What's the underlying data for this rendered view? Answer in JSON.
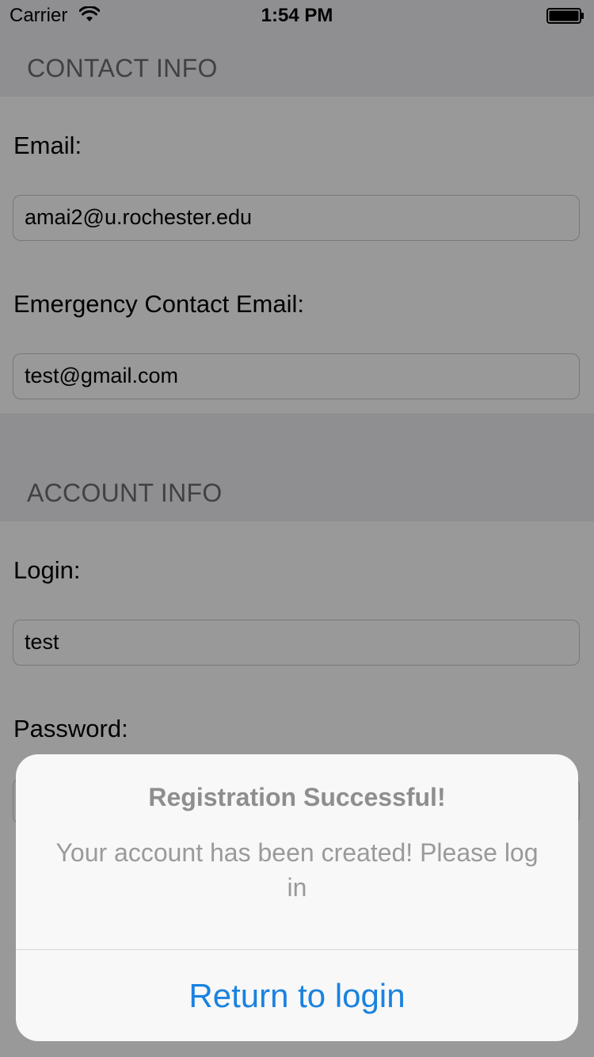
{
  "status_bar": {
    "carrier": "Carrier",
    "time": "1:54 PM"
  },
  "contact_section": {
    "title": "CONTACT INFO",
    "email_label": "Email:",
    "email_value": "amai2@u.rochester.edu",
    "emergency_label": "Emergency Contact Email:",
    "emergency_value": "test@gmail.com"
  },
  "account_section": {
    "title": "ACCOUNT INFO",
    "login_label": "Login:",
    "login_value": "test",
    "password_label": "Password:"
  },
  "alert": {
    "title": "Registration Successful!",
    "message": "Your account has been created! Please log in",
    "button_label": "Return to login"
  },
  "colors": {
    "accent": "#1a82e0",
    "header_bg": "#efeff4"
  },
  "icons": [
    "wifi-icon",
    "battery-icon"
  ]
}
